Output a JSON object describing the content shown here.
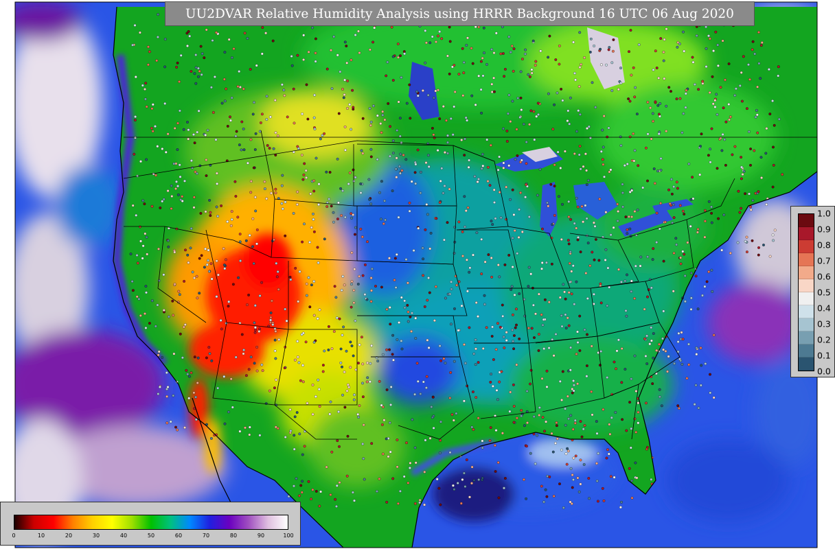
{
  "title": "UU2DVAR Relative Humidity Analysis using HRRR Background 16 UTC 06 Aug 2020",
  "main_colorbar": {
    "ticks": [
      "0",
      "10",
      "20",
      "30",
      "40",
      "50",
      "60",
      "70",
      "80",
      "90",
      "100"
    ],
    "stops": [
      "#1a0000",
      "#cc0000",
      "#ff0000",
      "#ff8000",
      "#ffd000",
      "#ffff00",
      "#a0e000",
      "#00c000",
      "#00c080",
      "#0088ff",
      "#2020e0",
      "#6a00c0",
      "#a050c0",
      "#e0c0e0",
      "#ffffff"
    ]
  },
  "station_colorbar": {
    "ticks": [
      "1.0",
      "0.9",
      "0.8",
      "0.7",
      "0.6",
      "0.5",
      "0.4",
      "0.3",
      "0.2",
      "0.1",
      "0.0"
    ],
    "colors": [
      "#6b0a10",
      "#a8182a",
      "#cc3c33",
      "#e57555",
      "#f2aa8a",
      "#f9d6c6",
      "#f0f0f0",
      "#cfe1ea",
      "#a6c4d1",
      "#789fb1",
      "#4d7a92",
      "#2a5470"
    ]
  },
  "map_colors": {
    "ocean_base": "#2a55e6",
    "land_base": "#13a520",
    "dry_core": "#ff1a00",
    "border": "#000000"
  }
}
